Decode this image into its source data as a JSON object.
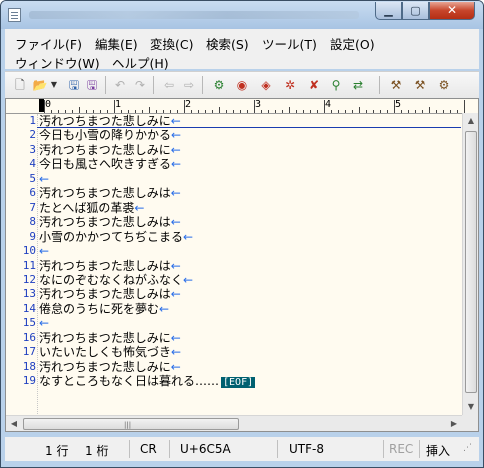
{
  "window": {
    "title": ""
  },
  "menu": {
    "file": "ファイル(F)",
    "edit": "編集(E)",
    "convert": "変換(C)",
    "search": "検索(S)",
    "tool": "ツール(T)",
    "settings": "設定(O)",
    "window": "ウィンドウ(W)",
    "help": "ヘルプ(H)"
  },
  "ruler": {
    "numbers": [
      "0",
      "1",
      "2",
      "3",
      "4",
      "5"
    ]
  },
  "editor": {
    "line_numbers": [
      "1",
      "2",
      "3",
      "4",
      "5",
      "6",
      "7",
      "8",
      "9",
      "10",
      "11",
      "12",
      "13",
      "14",
      "15",
      "16",
      "17",
      "18",
      "19"
    ],
    "lines": [
      "汚れつちまつた悲しみに",
      "今日も小雪の降りかかる",
      "汚れつちまつた悲しみに",
      "今日も風さへ吹きすぎる",
      "",
      "汚れつちまつた悲しみは",
      "たとへば狐の革裘",
      "汚れつちまつた悲しみは",
      "小雪のかかつてちぢこまる",
      "",
      "汚れつちまつた悲しみは",
      "なにのぞむなくねがふなく",
      "汚れつちまつた悲しみは",
      "倦怠のうちに死を夢む",
      "",
      "汚れつちまつた悲しみに",
      "いたいたしくも怖気づき",
      "汚れつちまつた悲しみに",
      "なすところもなく日は暮れる……"
    ],
    "newline_mark": "←",
    "eof_mark": "[EOF]"
  },
  "status": {
    "row": "1 行",
    "col": "1 桁",
    "linebreak": "CR",
    "codepoint": "U+6C5A",
    "encoding": "UTF-8",
    "rec": "REC",
    "mode": "挿入"
  },
  "colors": {
    "editor_bg": "#fffbf0",
    "line_number": "#2040c0",
    "newline_arrow": "#2a6ee8",
    "eof_bg": "#006070"
  }
}
